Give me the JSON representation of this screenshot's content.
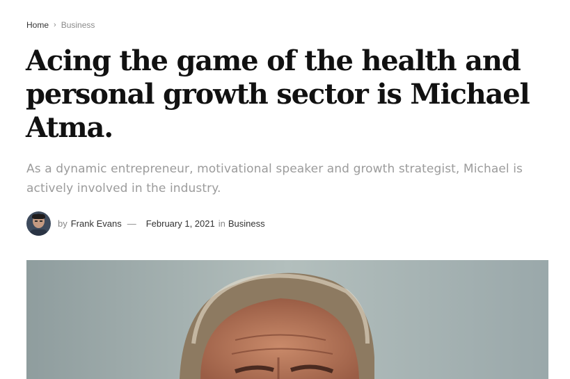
{
  "breadcrumb": {
    "home": "Home",
    "separator": "›",
    "current": "Business"
  },
  "article": {
    "title": "Acing the game of the health and personal growth sector is Michael Atma.",
    "subtitle": "As a dynamic entrepreneur, motivational speaker and growth strategist, Michael is actively involved in the industry.",
    "meta": {
      "by_label": "by",
      "author": "Frank Evans",
      "dash": "—",
      "date": "February 1, 2021",
      "in_label": "in",
      "category": "Business"
    },
    "hero_image": {
      "icon": "portrait-photo",
      "background_color": "#a9b6b6"
    }
  },
  "colors": {
    "text": "#111111",
    "muted": "#9b9b9b",
    "breadcrumb_current": "#8a8a8a"
  }
}
